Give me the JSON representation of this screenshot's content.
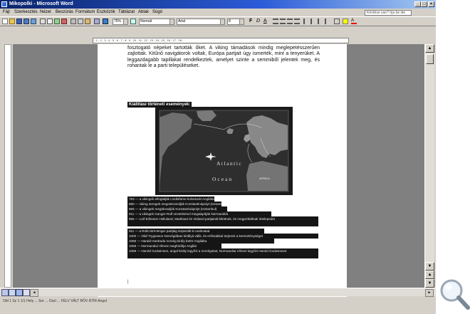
{
  "window": {
    "title": "Mikopolki - Microsoft Word",
    "controls": {
      "minimize": "_",
      "maximize": "□",
      "close": "×"
    }
  },
  "menubar": {
    "items": [
      "Fájl",
      "Szerkesztés",
      "Nézet",
      "Beszúrás",
      "Formátum",
      "Eszközök",
      "Táblázat",
      "Ablak",
      "Súgó"
    ],
    "help_placeholder": "Kérdése van? Írja be ide"
  },
  "toolbar": {
    "zoom": "75%",
    "style": "Normál",
    "font": "Arial",
    "size": "8"
  },
  "document": {
    "paragraph": "fosztogató népeket tartották őket. A viking támadások mindig meglepetésszerűen zajlottak. Kitűnő navigátorok voltak, Európa partjait úgy ismerték, mint a tenyerüket. A leggazdagabb tapillakat rendelkeztek, amelyet szinte a semmiből jelentek meg, és rohantak le a parti településeket.",
    "section_title": "Kiállítási történeti események:",
    "map_labels": {
      "ocean1": "Atlantic",
      "ocean2": "Ocean",
      "africa": "AFRICA"
    },
    "events": [
      "793 — a vikingek elfoglalják Lindisfarne kolostorát Angliában",
      "860 — viking seregek megostromolják Konstantinápolyt (Isztambul)",
      "865 — a vikingek megtámadják Konstantinápolyt (Isztambul)",
      "911 — a vikingek Ganger-Rolf vezetésével megalapítják Normandiát",
      "955 — Leif Eriksson Helluland, Markland és Vinland partjainál kikötnek, és megpróbálnak letelepedni",
      "911 — a Rollo Brit-tenger partjáig terjesztik ki uralmukat",
      "1000 — Olaf Trygvason Norvégiában királlyá válik, és erőszakkal terjeszti a kereszténységet",
      "1066 — Harald Hardrada norvég király betör Angliába",
      "1066 — Normandiai Vilmos meghódítja Angliát",
      "1066 — Harold Godwinson, angol király legyőzi a norvégokat, Normandiai Vilmos legyőzi Harold Godwinsont"
    ]
  },
  "statusbar": {
    "text": "Old  1   Sz  1   1/1   Hely  ...   Sor   ...   Oszl   ...   FELV  VÁLT  BŐV  ÁTÍR   Angol"
  }
}
